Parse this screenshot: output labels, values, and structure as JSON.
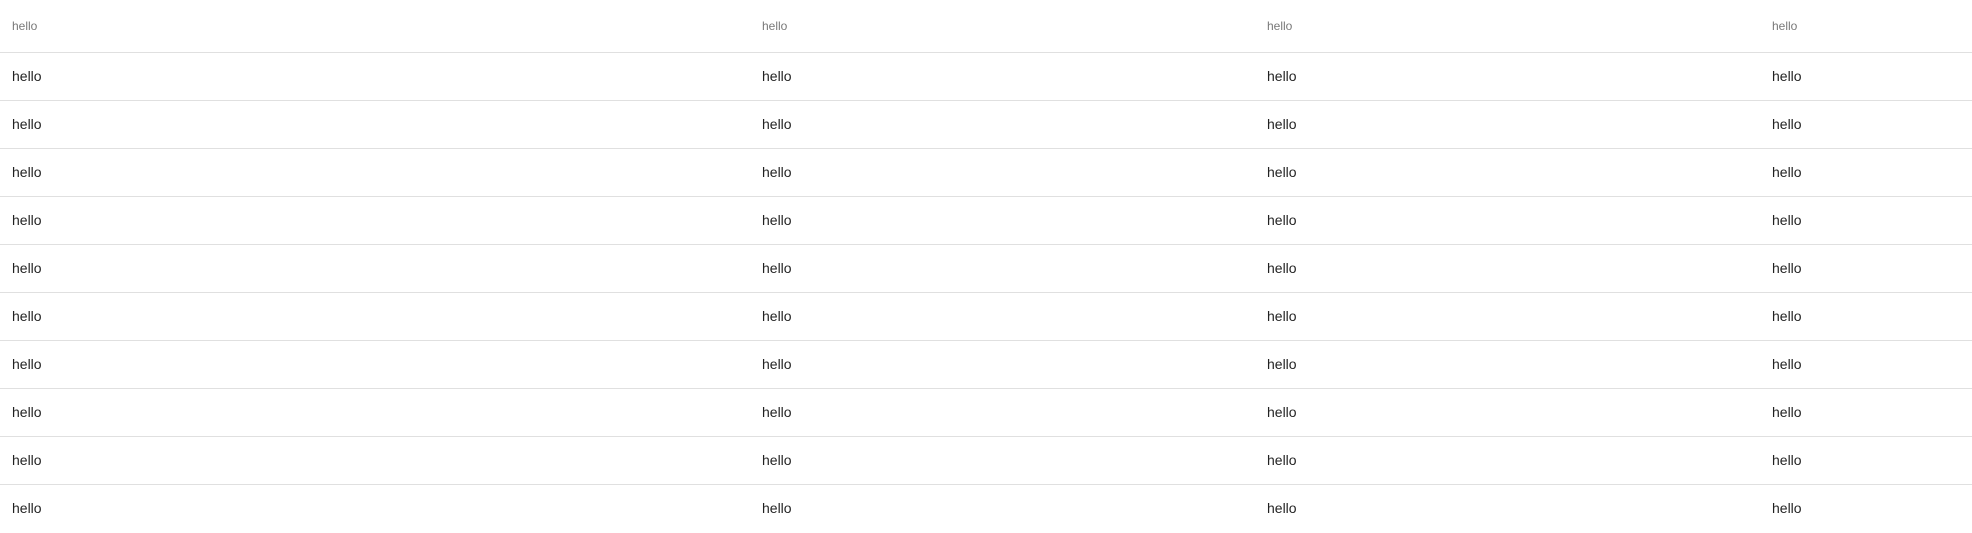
{
  "table": {
    "headers": [
      "hello",
      "hello",
      "hello",
      "hello"
    ],
    "rows": [
      [
        "hello",
        "hello",
        "hello",
        "hello"
      ],
      [
        "hello",
        "hello",
        "hello",
        "hello"
      ],
      [
        "hello",
        "hello",
        "hello",
        "hello"
      ],
      [
        "hello",
        "hello",
        "hello",
        "hello"
      ],
      [
        "hello",
        "hello",
        "hello",
        "hello"
      ],
      [
        "hello",
        "hello",
        "hello",
        "hello"
      ],
      [
        "hello",
        "hello",
        "hello",
        "hello"
      ],
      [
        "hello",
        "hello",
        "hello",
        "hello"
      ],
      [
        "hello",
        "hello",
        "hello",
        "hello"
      ],
      [
        "hello",
        "hello",
        "hello",
        "hello"
      ]
    ]
  },
  "colors": {
    "header_text": "#757575",
    "cell_text": "#212121",
    "divider": "#e0e0e0",
    "background": "#ffffff"
  }
}
